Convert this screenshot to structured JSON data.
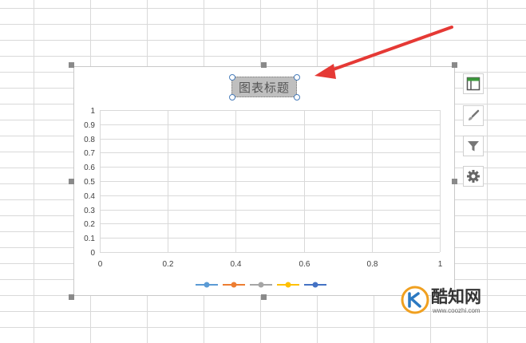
{
  "chart": {
    "title": "图表标题",
    "y_ticks": [
      "1",
      "0.9",
      "0.8",
      "0.7",
      "0.6",
      "0.5",
      "0.4",
      "0.3",
      "0.2",
      "0.1",
      "0"
    ],
    "x_ticks": [
      "0",
      "0.2",
      "0.4",
      "0.6",
      "0.8",
      "1"
    ],
    "legend_colors": [
      "#5b9bd5",
      "#ed7d31",
      "#a5a5a5",
      "#ffc000",
      "#4472c4"
    ]
  },
  "chart_data": {
    "type": "line",
    "x": [],
    "series": [
      {
        "values": []
      },
      {
        "values": []
      },
      {
        "values": []
      },
      {
        "values": []
      },
      {
        "values": []
      }
    ],
    "xlim": [
      0,
      1
    ],
    "ylim": [
      0,
      1
    ],
    "grid": true,
    "legend": "bottom"
  },
  "side_tools": {
    "icons": [
      "chart-elements-icon",
      "chart-style-brush-icon",
      "chart-filter-icon",
      "chart-settings-gear-icon"
    ]
  },
  "annotation": {
    "color": "#e53935"
  },
  "watermark": {
    "name": "酷知网",
    "url": "www.coozhi.com"
  }
}
